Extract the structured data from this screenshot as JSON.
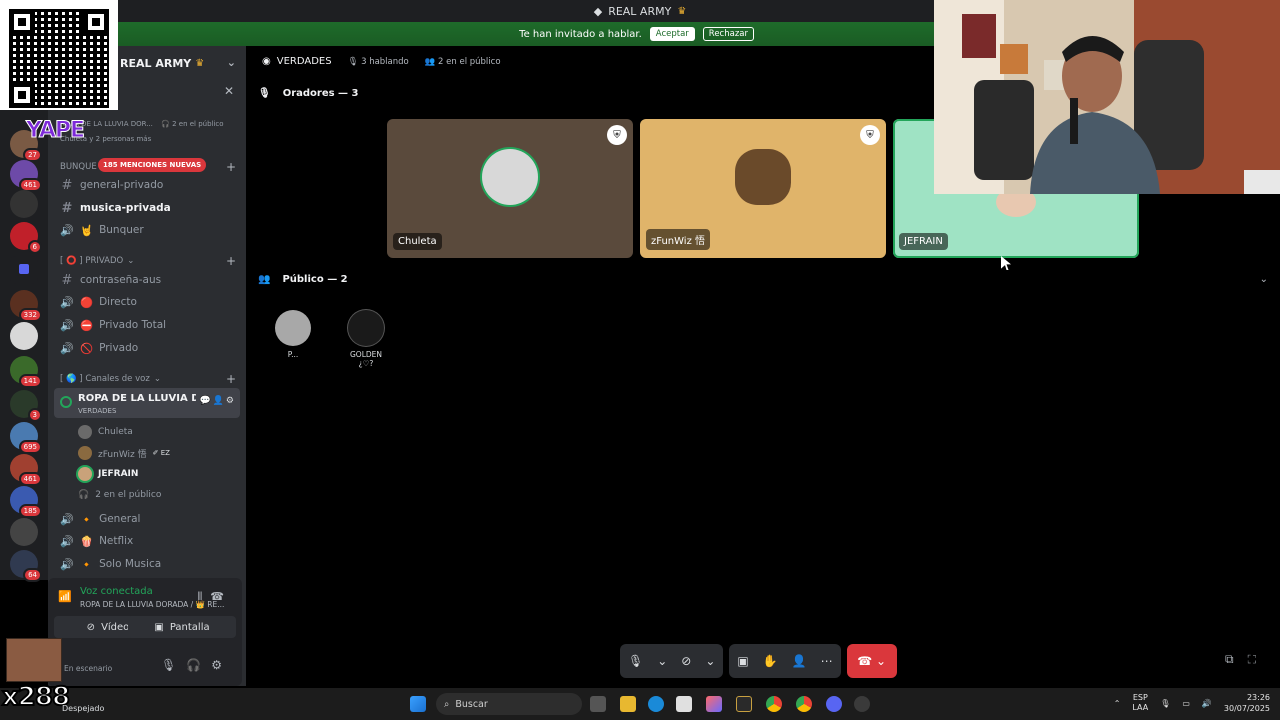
{
  "window": {
    "title": "REAL ARMY"
  },
  "invite": {
    "message": "Te han invitado a hablar.",
    "accept": "Aceptar",
    "reject": "Rechazar"
  },
  "server": {
    "name": "REAL ARMY"
  },
  "overlays": {
    "yape": "YAPE",
    "counter": "x288",
    "weather": "Despejado"
  },
  "event": {
    "title": "ROPA DE LA LLUVIA DOR...",
    "audience": "2 en el público",
    "participants": "Chuleta y 2 personas más"
  },
  "mentions_badge": "185 MENCIONES NUEVAS",
  "rail": {
    "badges": [
      "27",
      "461",
      "",
      "6",
      "",
      "332",
      "",
      "141",
      "3",
      "695",
      "461",
      "185",
      "",
      "64"
    ]
  },
  "sidebar": {
    "category_bunker": "BUNQUE",
    "channels_top": [
      {
        "type": "text",
        "name": "general-privado",
        "active": false
      },
      {
        "type": "text",
        "name": "musica-privada",
        "active": true
      },
      {
        "type": "voice",
        "name": "Bunquer",
        "emoji": "🤘"
      }
    ],
    "category_private": "[ ⭕ ] PRIVADO",
    "channels_private": [
      {
        "type": "text",
        "name": "contraseña-aus"
      },
      {
        "type": "voice",
        "name": "Directo",
        "emoji": "🔴"
      },
      {
        "type": "voice",
        "name": "Privado Total",
        "emoji": "⛔"
      },
      {
        "type": "voice",
        "name": "Privado",
        "emoji": "🚫"
      }
    ],
    "category_voice": "[ 🌎 ] Canales de voz",
    "stage_channel": {
      "name": "ROPA DE LA LLUVIA D...",
      "topic": "VERDADES"
    },
    "stage_members": [
      {
        "name": "Chuleta",
        "speaking": false,
        "tag": ""
      },
      {
        "name": "zFunWiz 悟",
        "speaking": false,
        "tag": "EZ"
      },
      {
        "name": "JEFRAIN",
        "speaking": true,
        "tag": ""
      }
    ],
    "stage_audience": "2 en el público",
    "channels_voice": [
      {
        "name": "General",
        "emoji": "🔸"
      },
      {
        "name": "Netflix",
        "emoji": "🍿"
      },
      {
        "name": "Solo Musica",
        "emoji": "🔸"
      }
    ]
  },
  "user_area": {
    "status": "Voz conectada",
    "location": "ROPA DE LA LLUVIA DORADA / 👑 RE...",
    "video": "Vídeo",
    "screen": "Pantalla",
    "user_status": "En escenario"
  },
  "stage": {
    "topic": "VERDADES",
    "speaking": "3 hablando",
    "audience_count": "2 en el público",
    "speakers_header": "Oradores — 3",
    "audience_header": "Público — 2",
    "speakers": [
      {
        "name": "Chuleta",
        "bg": "#5a4a3c",
        "moderator": true
      },
      {
        "name": "zFunWiz 悟",
        "bg": "#e0b46a",
        "moderator": true
      },
      {
        "name": "JEFRAIN",
        "bg": "#9fe3c4",
        "moderator": false
      }
    ],
    "audience": [
      {
        "name": "P..."
      },
      {
        "name": "GOLDEN ¿♡?"
      }
    ]
  },
  "taskbar": {
    "search_placeholder": "Buscar",
    "lang": "ESP",
    "layout": "LAA",
    "time": "23:26",
    "date": "30/07/2025"
  }
}
